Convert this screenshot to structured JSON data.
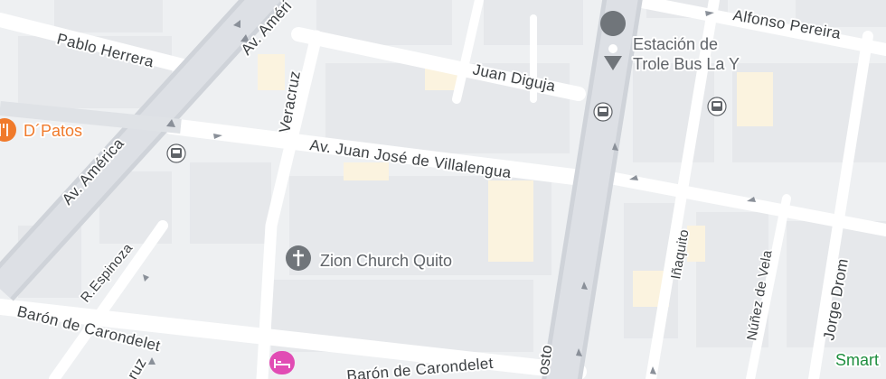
{
  "map": {
    "colors": {
      "background": "#f2f3f5",
      "block": "#e8eaed",
      "block_warm": "#fdf6e3",
      "road": "#ffffff",
      "major_road": "#d6dae0",
      "poi_dark": "#70757a",
      "restaurant": "#f07a2b",
      "hotel": "#e14cb4",
      "transit": "#5f6368",
      "park_text": "#1e8e3e"
    },
    "streets": {
      "pablo_herrera": "Pablo Herrera",
      "av_america_top": "Av. Améri",
      "av_america": "Av. América",
      "veracruz": "Veracruz",
      "juan_diguja": "Juan Diguja",
      "av_juan_jose": "Av. Juan José de Villalengua",
      "alfonso_pereira": "Alfonso Pereira",
      "r_espinoza": "R.Espinoza",
      "baron_carondelet_left": "Barón de Carondelet",
      "baron_carondelet_right": "Barón de Carondelet",
      "inaquito": "Iñaquito",
      "nunez_de_vela": "Núñez de Vela",
      "jorge_drom": "Jorge Drom",
      "osto": "osto",
      "ruz": "ruz"
    },
    "pois": {
      "dpatos": {
        "name": "D´Patos",
        "icon": "restaurant-icon"
      },
      "estacion": {
        "line1": "Estación de",
        "line2": "Trole Bus La Y",
        "icon": "place-pin-icon"
      },
      "zion": {
        "name": "Zion Church Quito",
        "icon": "church-cross-icon"
      },
      "smart": {
        "name": "Smart"
      },
      "hotel": {
        "icon": "hotel-bed-icon"
      }
    }
  }
}
